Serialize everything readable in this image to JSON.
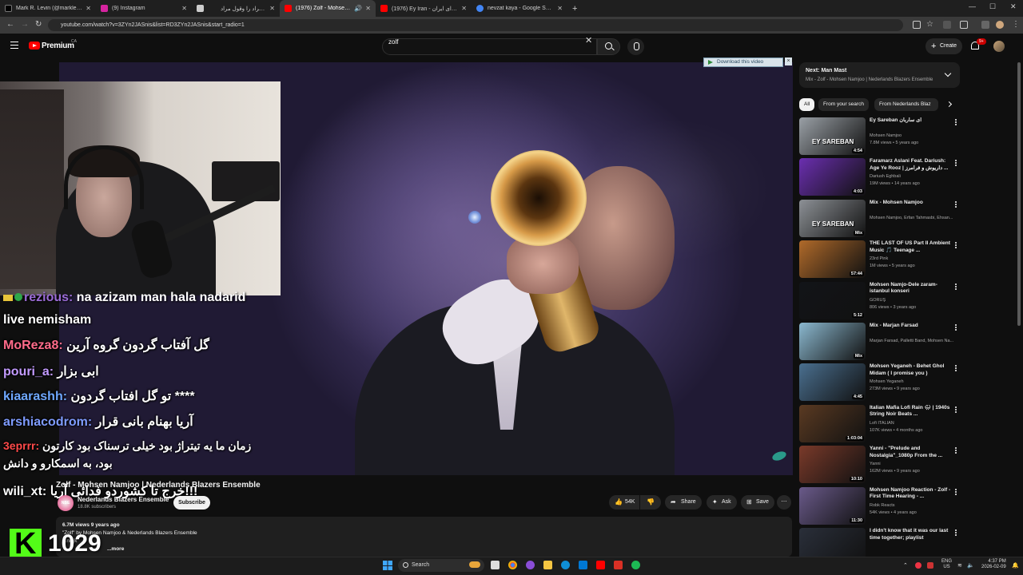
{
  "browser": {
    "tabs": [
      {
        "title": "Mark R. Levin (@marklevinshow)",
        "color": "#000000"
      },
      {
        "title": "(9) Instagram",
        "color": "#d6249f"
      },
      {
        "title": "",
        "color": "#cccccc"
      },
      {
        "title": "وقف مراد را وقول مراد",
        "color": "#3a3a3a"
      },
      {
        "title": "(1976) Zolf - Mohsen Namjoo",
        "color": "#ff0000"
      },
      {
        "title": "(1976) Ey Iran - ای ایران (Arash)",
        "color": "#ff0000"
      },
      {
        "title": "nevzat kaya - Google Search",
        "color": "#4285f4"
      }
    ],
    "new_tab": "+",
    "url": "youtube.com/watch?v=3ZYn2JASnis&list=RD3ZYn2JASnis&start_radio=1"
  },
  "youtube": {
    "brand": "Premium",
    "region": "CA",
    "search_value": "zolf",
    "create_label": "Create",
    "notification_badge": "9+"
  },
  "player": {
    "download_label": "Download this video",
    "download_close": "×"
  },
  "stream": {
    "chat_partial": {
      "user": "rezious:",
      "text": "na azizam man hala nadarid"
    },
    "chat": [
      {
        "user": "",
        "text": "live nemisham",
        "color": "#ffffff"
      },
      {
        "user": "MoReza8:",
        "text": "گل آفتاب گردون گروه آرین",
        "color": "#ff6b8a"
      },
      {
        "user": "pouri_a:",
        "text": "ابی بزار",
        "color": "#c39bff"
      },
      {
        "user": "kiaarashh:",
        "text": "تو گل افتاب گردون ****",
        "color": "#6fa8ff"
      },
      {
        "user": "arshiacodrom:",
        "text": "آریا بهنام بانی قرار",
        "color": "#7f9cff"
      },
      {
        "user": "3eprrr:",
        "text": "زمان ما یه تیتراژ بود خیلی ترسناک بود کارتون",
        "color": "#ff4a4a"
      },
      {
        "user": "",
        "text": "بود، به اسمکارو و دانش",
        "color": "#ffffff"
      },
      {
        "user": "wili_xt:",
        "text": "خرج تا کشوردو فدائی آریا!!!",
        "color": "#ffffff"
      }
    ],
    "viewer_count": "1029"
  },
  "video": {
    "title": "Zolf - Mohsen Namjoo | Nederlands Blazers Ensemble",
    "channel": "Nederlands Blazers Ensemble",
    "channel_avatar_text": "NBE",
    "subscribers": "18.8K subscribers",
    "subscribe_label": "Subscribe",
    "likes": "54K",
    "share_label": "Share",
    "ask_label": "Ask",
    "save_label": "Save",
    "views_age": "6.7M views  9 years ago",
    "desc_line1": "\"Zolf\" by Mohsen Namjoo & Nederlands Blazers Ensemble",
    "desc_line2": "...rwijk",
    "more": "...more"
  },
  "sidebar": {
    "next_label": "Next: Man Mast",
    "next_sub": "Mix - Zolf - Mohsen Namjoo | Nederlands Blazers Ensemble",
    "chips": [
      "All",
      "From your search",
      "From Nederlands Blaz"
    ],
    "recs": [
      {
        "title": "Ey Sareban ای ساربان",
        "channel": "Mohsen Namjoo",
        "stats": "7.8M views • 5 years ago",
        "duration": "4:54",
        "overlay": "EY SAREBAN",
        "bg": "#9aa0a6"
      },
      {
        "title": "Faramarz Aslani Feat. Dariush: Age Ye Rooz | داریوش و فرامرز ...",
        "channel": "Dariush Eghbali",
        "stats": "19M views • 14 years ago",
        "duration": "4:03",
        "overlay": "",
        "bg": "#6b2fb0"
      },
      {
        "title": "Mix - Mohsen Namjoo",
        "channel": "Mohsen Namjoo, Erfan Tahmasbi, Ehsan...",
        "stats": "",
        "duration": "Mix",
        "overlay": "EY SAREBAN",
        "bg": "#8d9196"
      },
      {
        "title": "THE LAST OF US Part II Ambient Music 🎵 Teenage ...",
        "channel": "23rd Pink",
        "stats": "1M views • 5 years ago",
        "duration": "57:44",
        "overlay": "",
        "bg": "#b06a2a"
      },
      {
        "title": "Mohsen Namjo-Dele zaram-istanbul konseri",
        "channel": "GÖRÜŞ",
        "stats": "806 views • 3 years ago",
        "duration": "5:12",
        "overlay": "",
        "bg": "#121418"
      },
      {
        "title": "Mix - Marjan Farsad",
        "channel": "Marjan Farsad, Palletti Band, Mohsen Na...",
        "stats": "",
        "duration": "Mix",
        "overlay": "",
        "bg": "#8bb8cf"
      },
      {
        "title": "Mohsen Yeganeh - Behet Ghol Midam ( I promise you )",
        "channel": "Mohsen Yeganeh",
        "stats": "273M views • 9 years ago",
        "duration": "4:45",
        "overlay": "",
        "bg": "#4a6f8f"
      },
      {
        "title": "Italian Mafia Lofi Rain 🌧 | 1940s String Noir Beats ...",
        "channel": "Lofi ITALIAN",
        "stats": "107K views • 4 months ago",
        "duration": "1:03:04",
        "overlay": "",
        "bg": "#5a3a22"
      },
      {
        "title": "Yanni - \"Prelude and Nostalgia\"_1080p From the ...",
        "channel": "Yanni",
        "stats": "162M views • 9 years ago",
        "duration": "10:10",
        "overlay": "",
        "bg": "#7a3a2a"
      },
      {
        "title": "Mohsen Namjoo Reaction - Zolf - First Time Hearing - ...",
        "channel": "Robk Reacts",
        "stats": "54K views • 4 years ago",
        "duration": "11:30",
        "overlay": "",
        "bg": "#6a5a8a"
      },
      {
        "title": "I didn't know that it was our last time together; playlist",
        "channel": "",
        "stats": "",
        "duration": "",
        "overlay": "",
        "bg": "#2a2f3a"
      }
    ]
  },
  "taskbar": {
    "search_label": "Search",
    "lang": "ENG",
    "lang2": "US",
    "time": "4:37 PM",
    "date": "2026-02-09"
  }
}
